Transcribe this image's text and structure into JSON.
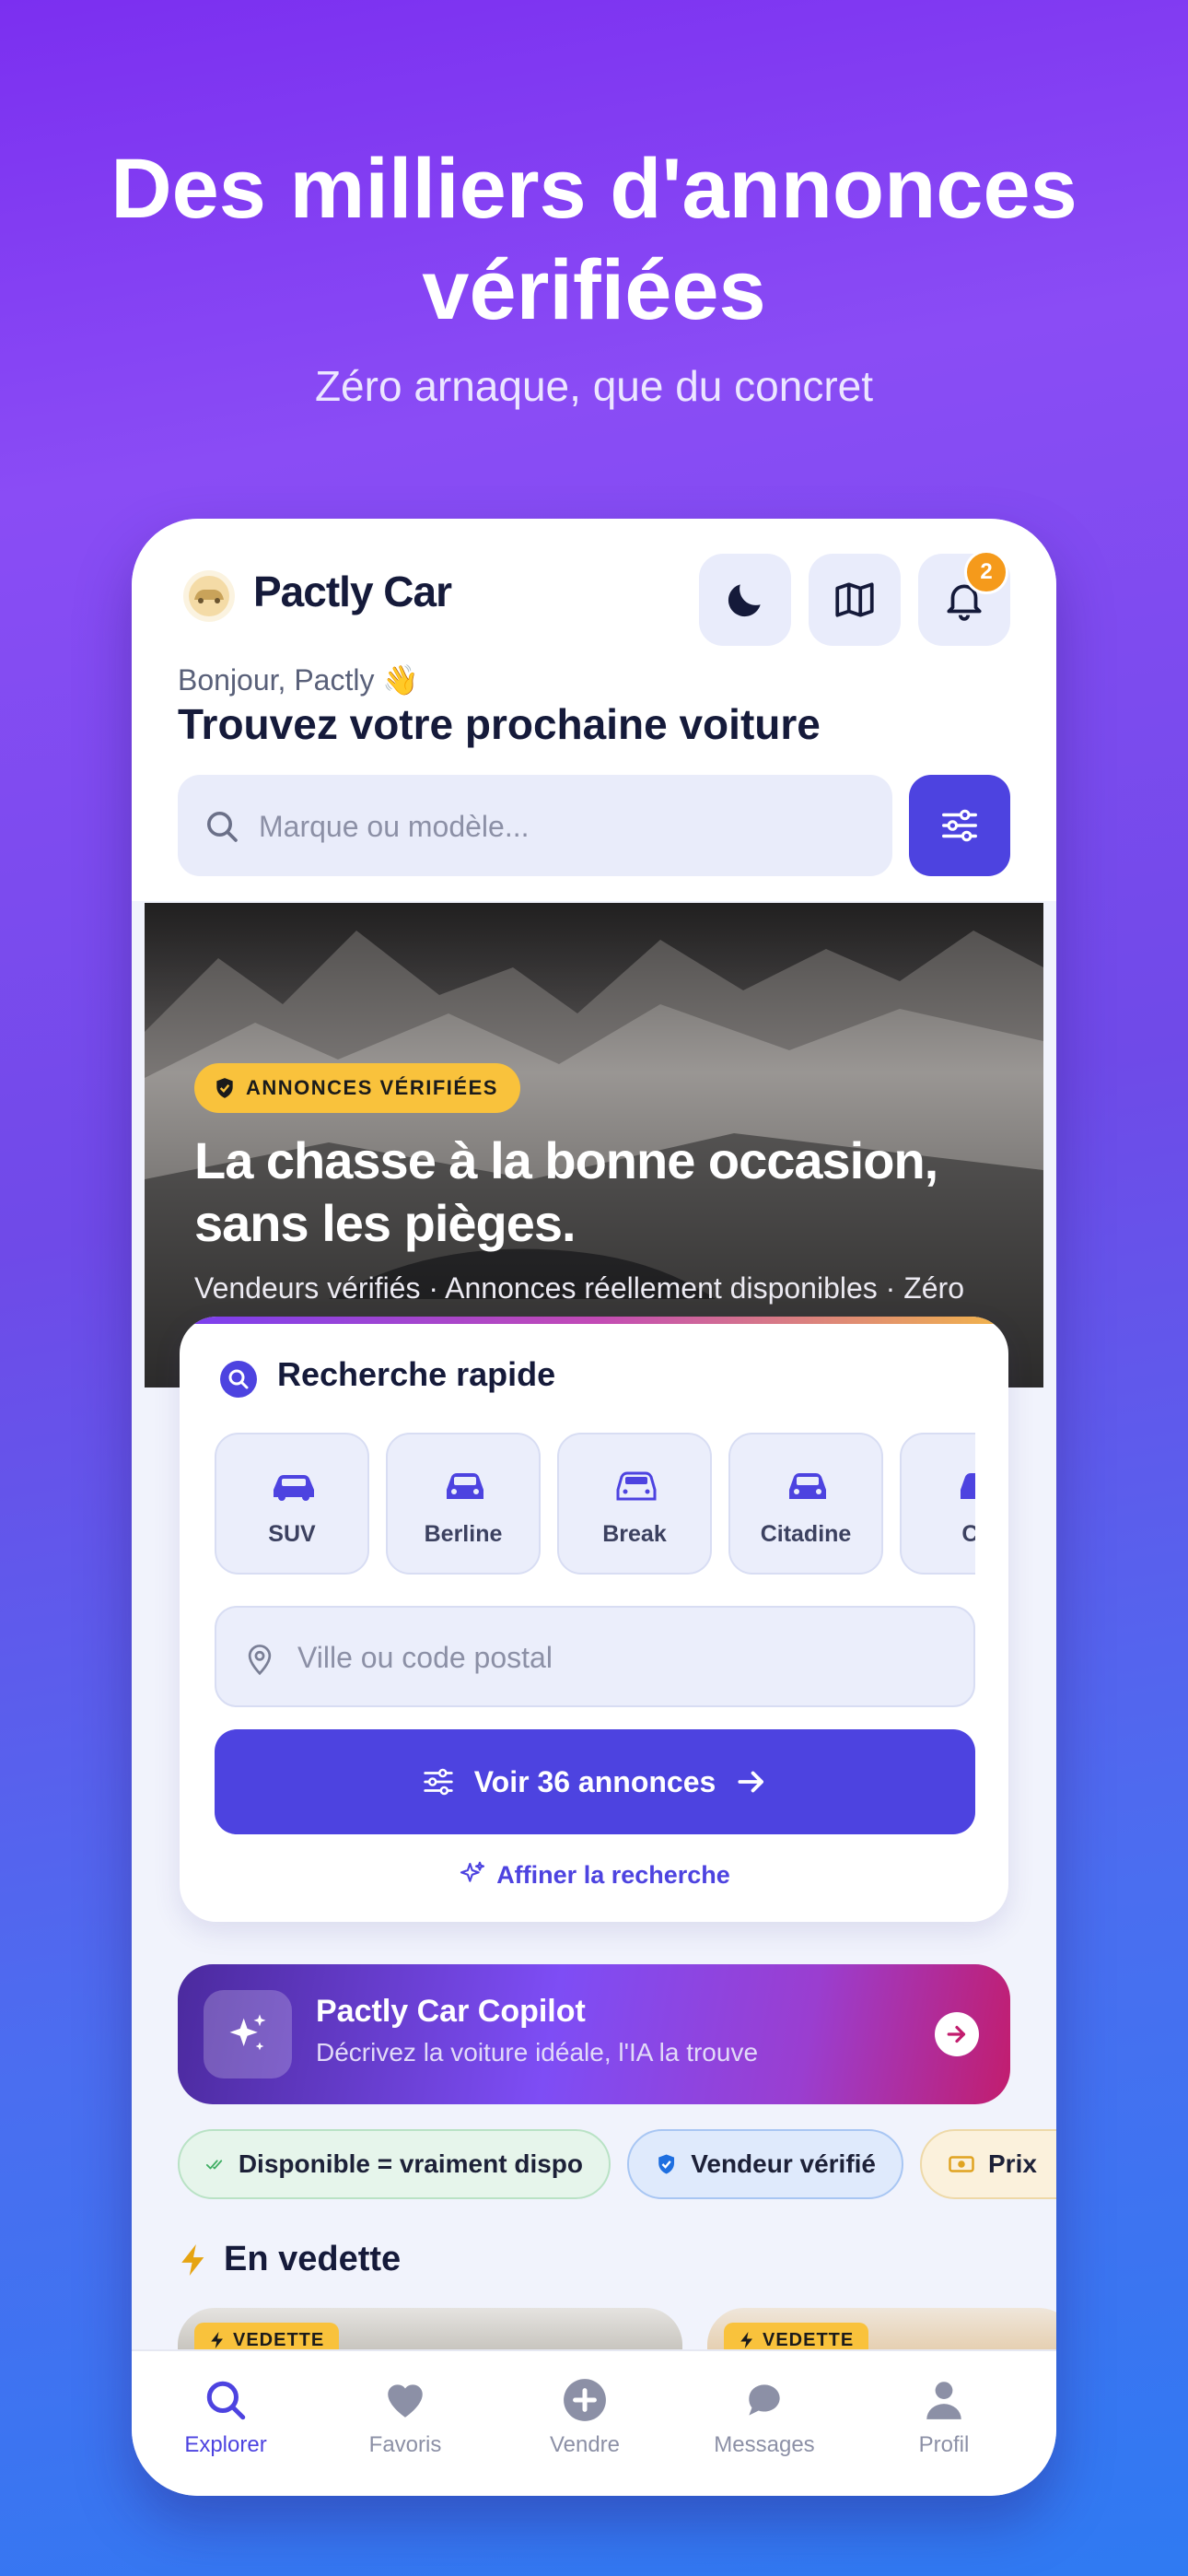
{
  "promo": {
    "title_line1": "Des milliers d'annonces",
    "title_line2": "vérifiées",
    "subtitle": "Zéro arnaque, que du concret"
  },
  "header": {
    "app_name": "Pactly Car",
    "notification_count": "2",
    "greeting": "Bonjour, Pactly 👋",
    "headline": "Trouvez votre prochaine voiture",
    "icons": [
      "moon-icon",
      "map-icon",
      "bell-icon"
    ]
  },
  "search": {
    "placeholder": "Marque ou modèle...",
    "value": ""
  },
  "banner": {
    "badge": "ANNONCES VÉRIFIÉES",
    "title": "La chasse à la bonne occasion, sans les pièges.",
    "subtitle": "Vendeurs vérifiés · Annonces réellement disponibles · Zéro"
  },
  "quick_search": {
    "title": "Recherche rapide",
    "body_types": [
      {
        "label": "SUV"
      },
      {
        "label": "Berline"
      },
      {
        "label": "Break"
      },
      {
        "label": "Citadine"
      },
      {
        "label": "Co"
      }
    ],
    "location_placeholder": "Ville ou code postal",
    "cta_label": "Voir 36 annonces",
    "refine_label": "Affiner la recherche"
  },
  "copilot": {
    "title": "Pactly Car Copilot",
    "subtitle": "Décrivez la voiture idéale, l'IA la trouve"
  },
  "chips": [
    {
      "label": "Disponible = vraiment dispo",
      "icon": "double-check-icon"
    },
    {
      "label": "Vendeur vérifié",
      "icon": "shield-check-icon"
    },
    {
      "label": "Prix",
      "icon": "banknote-icon"
    }
  ],
  "featured": {
    "title": "En vedette",
    "card_badge": "VEDETTE"
  },
  "tabbar": {
    "items": [
      {
        "label": "Explorer",
        "icon": "search-icon",
        "active": true
      },
      {
        "label": "Favoris",
        "icon": "heart-icon"
      },
      {
        "label": "Vendre",
        "icon": "plus-circle-icon"
      },
      {
        "label": "Messages",
        "icon": "chat-icon"
      },
      {
        "label": "Profil",
        "icon": "user-icon"
      }
    ]
  },
  "colors": {
    "accent": "#4d43e0",
    "badge_yellow": "#f9c23c",
    "notification": "#f59a1b",
    "background_top": "#7b2ff0",
    "background_bottom": "#2f7af2"
  }
}
